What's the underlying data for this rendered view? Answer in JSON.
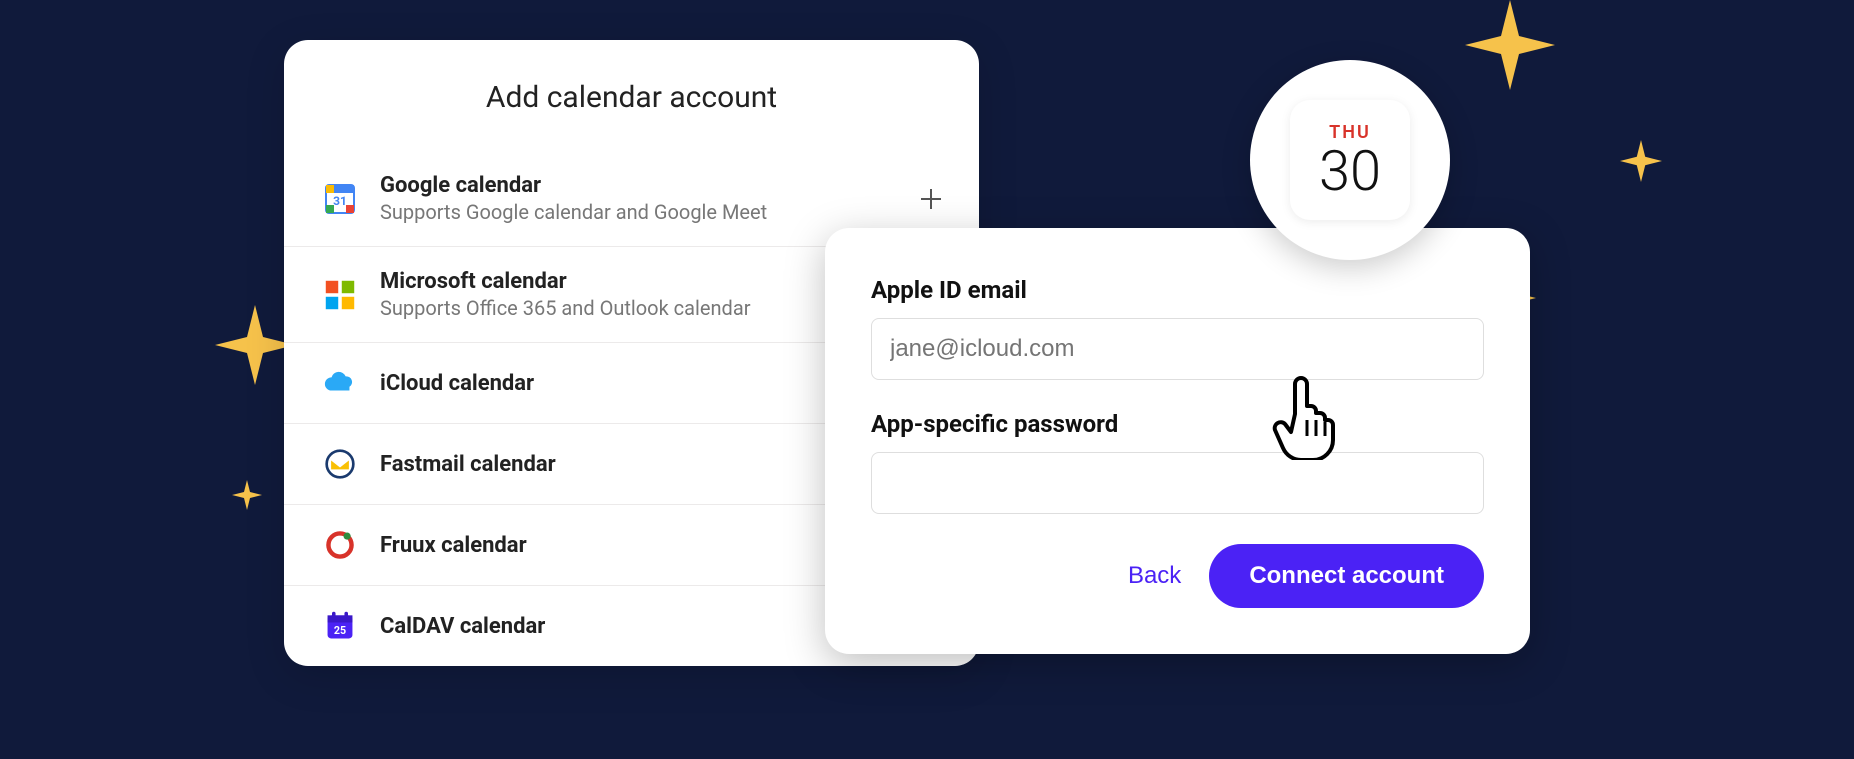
{
  "provider_panel": {
    "title": "Add calendar account",
    "items": [
      {
        "name": "Google calendar",
        "subtitle": "Supports Google calendar and Google Meet",
        "icon": "google-calendar",
        "show_plus": true
      },
      {
        "name": "Microsoft calendar",
        "subtitle": "Supports Office 365 and Outlook calendar",
        "icon": "microsoft",
        "show_plus": false
      },
      {
        "name": "iCloud calendar",
        "subtitle": "",
        "icon": "icloud",
        "show_plus": false
      },
      {
        "name": "Fastmail calendar",
        "subtitle": "",
        "icon": "fastmail",
        "show_plus": false
      },
      {
        "name": "Fruux calendar",
        "subtitle": "",
        "icon": "fruux",
        "show_plus": false
      },
      {
        "name": "CalDAV calendar",
        "subtitle": "",
        "icon": "caldav",
        "show_plus": true
      }
    ]
  },
  "dialog": {
    "email_label": "Apple ID email",
    "email_placeholder": "jane@icloud.com",
    "email_value": "",
    "password_label": "App-specific password",
    "password_value": "",
    "back_label": "Back",
    "connect_label": "Connect account"
  },
  "badge": {
    "day_name": "THU",
    "day_number": "30"
  },
  "colors": {
    "accent": "#4b22f5",
    "sparkle": "#f6c24b",
    "bg": "#101a3b"
  }
}
